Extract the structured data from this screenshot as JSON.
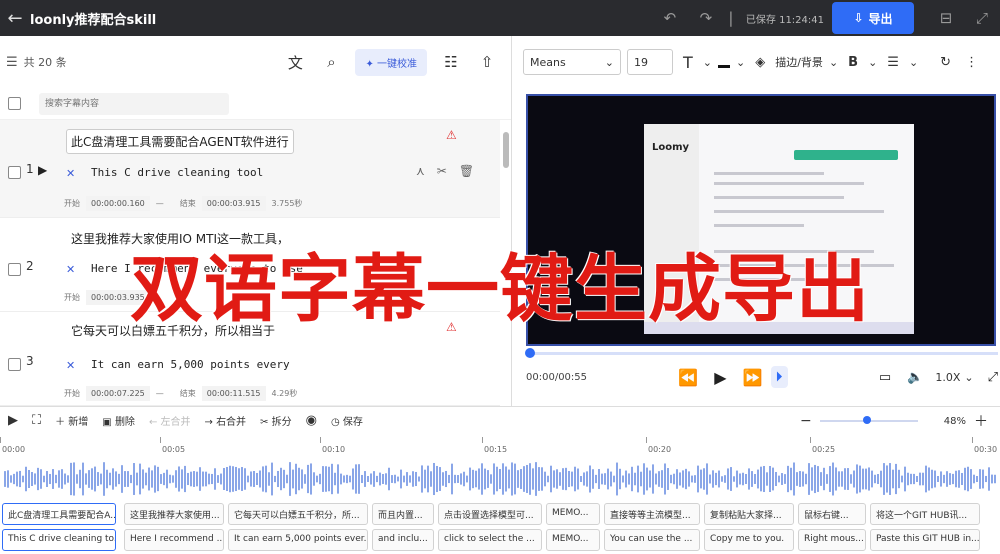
{
  "topbar": {
    "title": "loonly推荐配合skill",
    "saved": "已保存 11:24:41",
    "export_label": "导出"
  },
  "left_panel": {
    "count_label": "共 20 条",
    "proof_label": "一键校准",
    "search_placeholder": "搜索字幕内容",
    "segments": [
      {
        "num": "1",
        "zh": "此C盘清理工具需要配合AGENT软件进行",
        "en": "This C drive cleaning tool",
        "start_label": "开始",
        "start": "00:00:00.160",
        "end_label": "结束",
        "end": "00:00:03.915",
        "dur": "3.755秒",
        "warn": true
      },
      {
        "num": "2",
        "zh": "这里我推荐大家使用IO MTI这一款工具，",
        "en": "Here I recommend everyone to use",
        "start_label": "开始",
        "start": "00:00:03.935",
        "end_label": "结束",
        "end": "",
        "dur": "",
        "warn": false
      },
      {
        "num": "3",
        "zh": "它每天可以白嫖五千积分，所以相当于",
        "en": "It can earn 5,000 points every",
        "start_label": "开始",
        "start": "00:00:07.225",
        "end_label": "结束",
        "end": "00:00:11.515",
        "dur": "4.29秒",
        "warn": true
      }
    ]
  },
  "right_panel": {
    "font": "Means",
    "font_size": "19",
    "stroke_label": "描边/背景",
    "video_logo": "Loomy",
    "time": "00:00/00:55",
    "speed": "1.0X"
  },
  "timeline": {
    "tools": [
      "新增",
      "删除",
      "左合并",
      "右合并",
      "拆分",
      "保存"
    ],
    "zoom": "48%",
    "ruler": [
      "00:00",
      "00:05",
      "00:10",
      "00:15",
      "00:20",
      "00:25",
      "00:30"
    ],
    "clips_zh": [
      "此C盘清理工具需要配合A...",
      "这里我推荐大家使用...",
      "它每天可以白嫖五千积分，所...",
      "而且内置...",
      "点击设置选择模型可...",
      "MEMO...",
      "直接等等主流模型...",
      "复制粘贴大家择...",
      "鼠标右键...",
      "将这一个GIT HUB讯..."
    ],
    "clips_en": [
      "This C drive cleaning to...",
      "Here I recommend ...",
      "It can earn 5,000 points ever...",
      "and inclu...",
      "click to select the ...",
      "MEMO...",
      "You can use the ...",
      "Copy me to you.",
      "Right mous...",
      "Paste this GIT HUB in..."
    ]
  },
  "overlay_text": "双语字幕一键生成导出",
  "colors": {
    "accent": "#2f6cf6",
    "warning": "#e03030",
    "overlay": "#e11b14",
    "topbar": "#2a2b2f",
    "waveform": "#8aa6e8"
  }
}
